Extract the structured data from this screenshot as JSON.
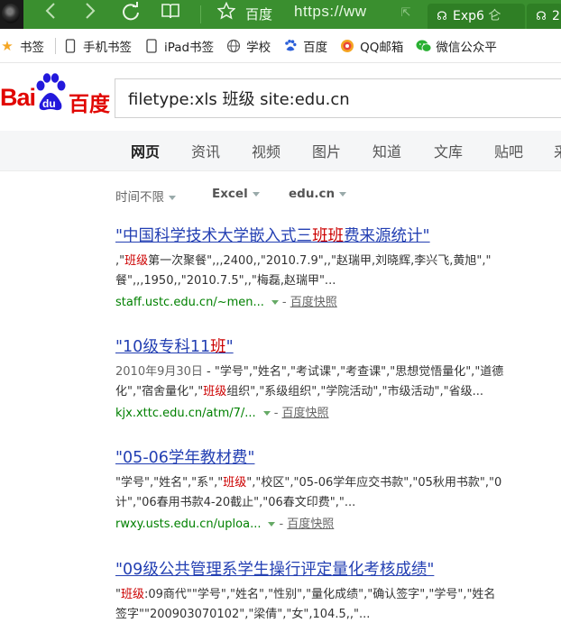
{
  "browser": {
    "baidu_label": "百度",
    "url_text": "https://ww",
    "tabs": [
      {
        "label": "Exp6"
      },
      {
        "label": "2"
      }
    ]
  },
  "bookmarks": [
    {
      "label": "书签",
      "icon": "star-icon"
    },
    {
      "label": "手机书签",
      "icon": "phone-icon"
    },
    {
      "label": "iPad书签",
      "icon": "tablet-icon"
    },
    {
      "label": "学校",
      "icon": "globe-icon"
    },
    {
      "label": "百度",
      "icon": "baidu-paw-icon"
    },
    {
      "label": "QQ邮箱",
      "icon": "qqmail-icon"
    },
    {
      "label": "微信公众平",
      "icon": "wechat-icon"
    }
  ],
  "logo": {
    "text_left": "Bai",
    "text_du": "du",
    "text_right": "百度"
  },
  "search": {
    "query": "filetype:xls 班级 site:edu.cn"
  },
  "nav": [
    "网页",
    "资讯",
    "视频",
    "图片",
    "知道",
    "文库",
    "贴吧",
    "采"
  ],
  "filters": [
    "时间不限",
    "Excel",
    "edu.cn"
  ],
  "results": [
    {
      "title_pre": "\"中国科学技术大学嵌入式三",
      "title_hl": "班班",
      "title_post": "费来源统计\"",
      "line1_pre": ",\"",
      "line1_hl": "班级",
      "line1_post": "第一次聚餐\",,,2400,,\"2010.7.9\",,\"赵瑞甲,刘晓辉,李兴飞,黄旭\",\"",
      "line2": "餐\",,,1950,,\"2010.7.5\",,\"梅磊,赵瑞甲\"...",
      "url": "staff.ustc.edu.cn/~men...",
      "snapshot": "百度快照"
    },
    {
      "title_pre": "\"10级专科11",
      "title_hl": "班",
      "title_post": "\"",
      "date": "2010年9月30日",
      "line1_post": " - \"学号\",\"姓名\",\"考试课\",\"考查课\",\"思想觉悟量化\",\"道德",
      "line2_pre": "化\",\"宿舍量化\",\"",
      "line2_hl": "班级",
      "line2_post": "组织\",\"系级组织\",\"学院活动\",\"市级活动\",\"省级...",
      "url": "kjx.xttc.edu.cn/atm/7/...",
      "snapshot": "百度快照"
    },
    {
      "title": "\"05-06学年教材费\"",
      "line1_pre": "\"学号\",\"姓名\",\"系\",\"",
      "line1_hl": "班级",
      "line1_post": "\",\"校区\",\"05-06学年应交书款\",\"05秋用书款\",\"0",
      "line2": "计\",\"06春用书款4-20截止\",\"06春文印费\",\"...",
      "url": "rwxy.usts.edu.cn/uploa...",
      "snapshot": "百度快照"
    },
    {
      "title": "\"09级公共管理系学生操行评定量化考核成绩\"",
      "line1_pre": "\"",
      "line1_hl": "班级",
      "line1_post": ":09商代\"\"学号\",\"姓名\",\"性别\",\"量化成绩\",\"确认签字\",\"学号\",\"姓名",
      "line2": "签字\"\"200903070102\",\"梁倩\",\"女\",104.5,,\"..."
    }
  ]
}
